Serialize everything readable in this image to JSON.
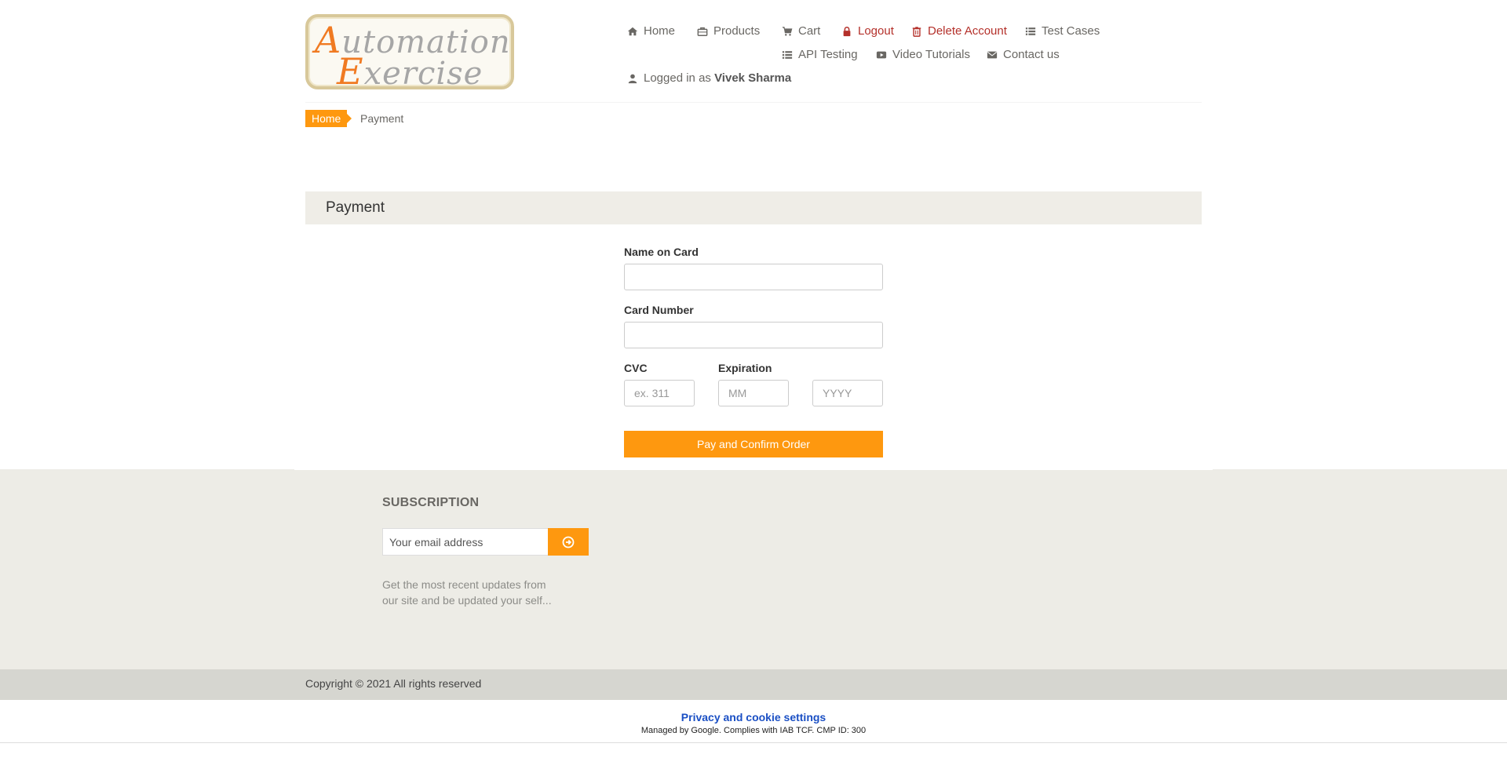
{
  "logo": {
    "line1_cap": "A",
    "line1_rest": "utomation",
    "line2_cap": "E",
    "line2_rest": "xercise"
  },
  "nav": {
    "home": "Home",
    "products": "Products",
    "cart": "Cart",
    "logout": "Logout",
    "delete_account": "Delete Account",
    "test_cases": "Test Cases",
    "api_testing": "API Testing",
    "video_tutorials": "Video Tutorials",
    "contact_us": "Contact us",
    "logged_in_prefix": "Logged in as",
    "logged_in_user": "Vivek Sharma"
  },
  "breadcrumb": {
    "home": "Home",
    "current": "Payment"
  },
  "payment": {
    "heading": "Payment",
    "name_label": "Name on Card",
    "name_value": "",
    "card_label": "Card Number",
    "card_value": "",
    "cvc_label": "CVC",
    "cvc_placeholder": "ex. 311",
    "expiration_label": "Expiration",
    "month_placeholder": "MM",
    "year_placeholder": "YYYY",
    "submit_label": "Pay and Confirm Order"
  },
  "subscription": {
    "title": "SUBSCRIPTION",
    "email_placeholder": "Your email address",
    "text": "Get the most recent updates from our site and be updated your self..."
  },
  "footer": {
    "copyright": "Copyright © 2021 All rights reserved"
  },
  "consent": {
    "link": "Privacy and cookie settings",
    "note": "Managed by Google. Complies with IAB TCF. CMP ID: 300"
  },
  "colors": {
    "accent": "#fe980f",
    "danger": "#b4302a",
    "footer_bg": "#edece6",
    "link": "#1a4fc4"
  }
}
